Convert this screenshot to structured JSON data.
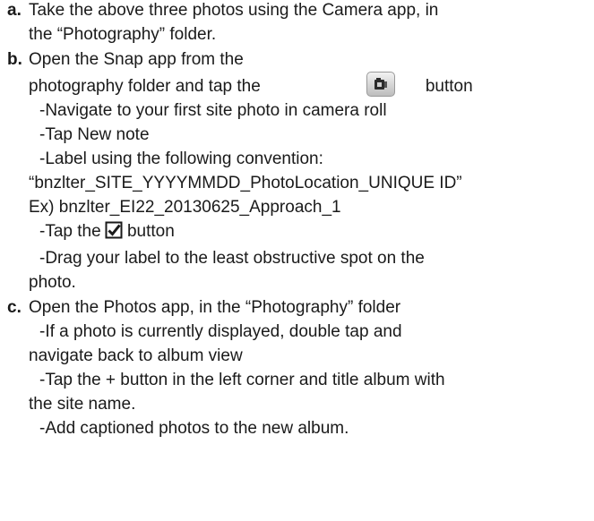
{
  "steps": {
    "a": {
      "letter": "a.",
      "line1": "Take the above three photos using the Camera app, in",
      "line2": "the “Photography” folder."
    },
    "b": {
      "letter": "b.",
      "line1": "Open the Snap app from the",
      "line2_before": "photography folder and tap the",
      "line2_after": "button",
      "camera_icon": "camera-button-icon",
      "sub1": "-Navigate to your first site photo in camera roll",
      "sub2": "-Tap New note",
      "sub3": "-Label using the following convention:",
      "sub4": "“bnzlter_SITE_YYYYMMDD_PhotoLocation_UNIQUE ID”",
      "sub5": "Ex) bnzlter_EI22_20130625_Approach_1",
      "sub6_before": "-Tap the",
      "sub6_after": "button",
      "check_icon": "checkbox-checked-icon",
      "sub7": "-Drag your label to the least obstructive spot on the",
      "sub8": "photo."
    },
    "c": {
      "letter": "c.",
      "line1": "Open the Photos app, in the “Photography” folder",
      "sub1": "-If a photo is currently displayed, double tap and",
      "sub2": "navigate back to album view",
      "sub3": "-Tap the + button in the left corner and title album with",
      "sub4": "the site name.",
      "sub5": "-Add captioned photos to the new album."
    }
  }
}
